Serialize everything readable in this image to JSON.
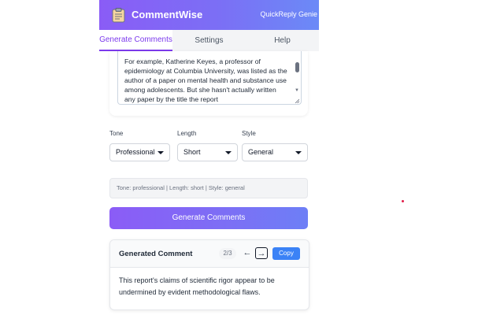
{
  "header": {
    "app_title": "CommentWise",
    "subtitle": "QuickReply Genie",
    "logo_icon": "clipboard-icon",
    "gradient_start": "#8a5cf6",
    "gradient_end": "#6b8af7"
  },
  "tabs": [
    {
      "label": "Generate Comments",
      "active": true
    },
    {
      "label": "Settings",
      "active": false
    },
    {
      "label": "Help",
      "active": false
    }
  ],
  "input_text": "For example, Katherine Keyes, a professor of epidemiology at Columbia University, was listed as the author of a paper on mental health and substance use among adolescents. But she hasn't actually written any paper by the title the report",
  "options": {
    "tone": {
      "label": "Tone",
      "value": "Professional"
    },
    "length": {
      "label": "Length",
      "value": "Short"
    },
    "style": {
      "label": "Style",
      "value": "General"
    }
  },
  "summary": "Tone: professional | Length: short | Style: general",
  "generate_button": "Generate Comments",
  "result": {
    "title": "Generated Comment",
    "counter": "2/3",
    "prev_arrow": "←",
    "next_arrow": "→",
    "copy_label": "Copy",
    "text": "This report's claims of scientific rigor appear to be undermined by evident methodological flaws."
  },
  "colors": {
    "accent": "#7c3aed",
    "copy_button": "#3b82f6"
  }
}
